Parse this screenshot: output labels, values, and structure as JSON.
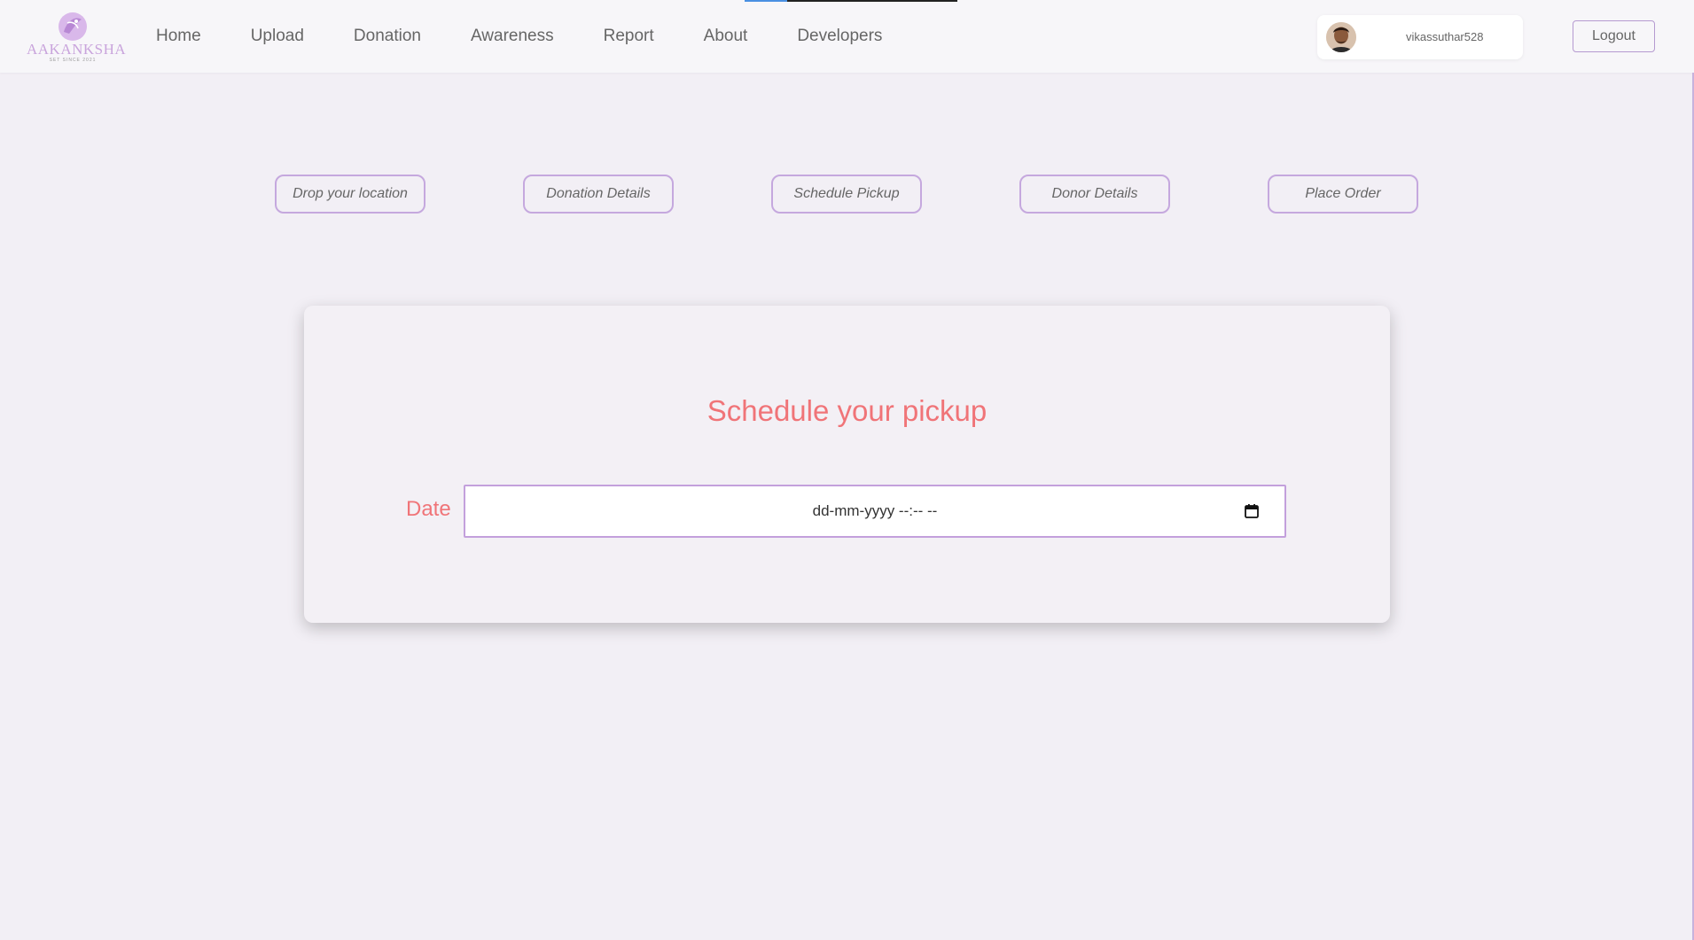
{
  "brand": {
    "name": "AAKANKSHA",
    "tagline": "SET SINCE 2021"
  },
  "nav": {
    "links": [
      "Home",
      "Upload",
      "Donation",
      "Awareness",
      "Report",
      "About",
      "Developers"
    ]
  },
  "user": {
    "username": "vikassuthar528",
    "logout_label": "Logout"
  },
  "steps": [
    "Drop your location",
    "Donation Details",
    "Schedule Pickup",
    "Donor Details",
    "Place Order"
  ],
  "form": {
    "title": "Schedule your pickup",
    "date_label": "Date",
    "date_value": "dd-mm-yyyy --:-- --"
  },
  "colors": {
    "accent": "#f07478",
    "border": "#c5a8de",
    "background": "#f2eff5"
  },
  "icons": {
    "calendar": "calendar-icon",
    "avatar": "user-avatar"
  }
}
